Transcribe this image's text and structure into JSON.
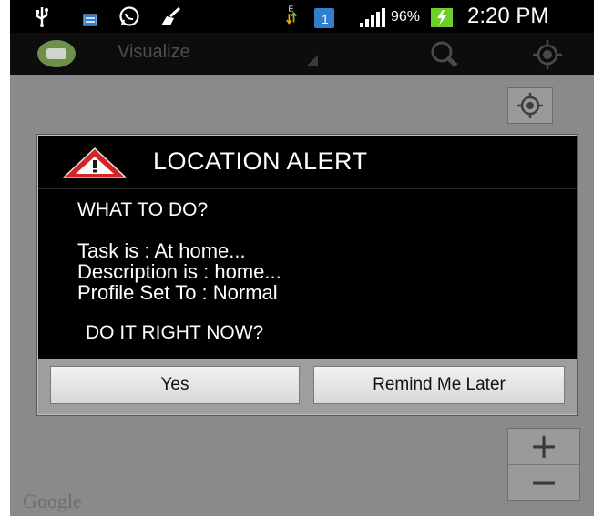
{
  "status_bar": {
    "battery_percent": "96%",
    "time": "2:20 PM",
    "icons": [
      "usb-icon",
      "message-icon",
      "whatsapp-icon",
      "cleaner-icon",
      "data-arrows-icon",
      "notification-icon",
      "signal-icon",
      "battery-charging-icon"
    ],
    "network_letter": "E",
    "notification_count": "1"
  },
  "action_bar": {
    "title": "Visualize",
    "icons": [
      "app-logo-icon",
      "search-icon",
      "my-location-icon"
    ]
  },
  "map": {
    "zoom_in_label": "+",
    "zoom_out_label": "−",
    "attribution": "Google"
  },
  "dialog": {
    "title": "LOCATION ALERT",
    "question": "WHAT TO DO?",
    "task": "Task is : At home...",
    "description": "Description is : home...",
    "profile": "Profile Set To : Normal",
    "prompt": "DO IT RIGHT NOW?",
    "yes_label": "Yes",
    "later_label": "Remind Me Later"
  },
  "colors": {
    "status_bar_bg": "#000000",
    "action_bar_bg": "#0d0d0d",
    "map_bg": "#8a8a8a",
    "dialog_bg": "#000000",
    "warning_red": "#d42424",
    "battery_green": "#6fcf2a",
    "notification_blue": "#2f7ecf"
  }
}
